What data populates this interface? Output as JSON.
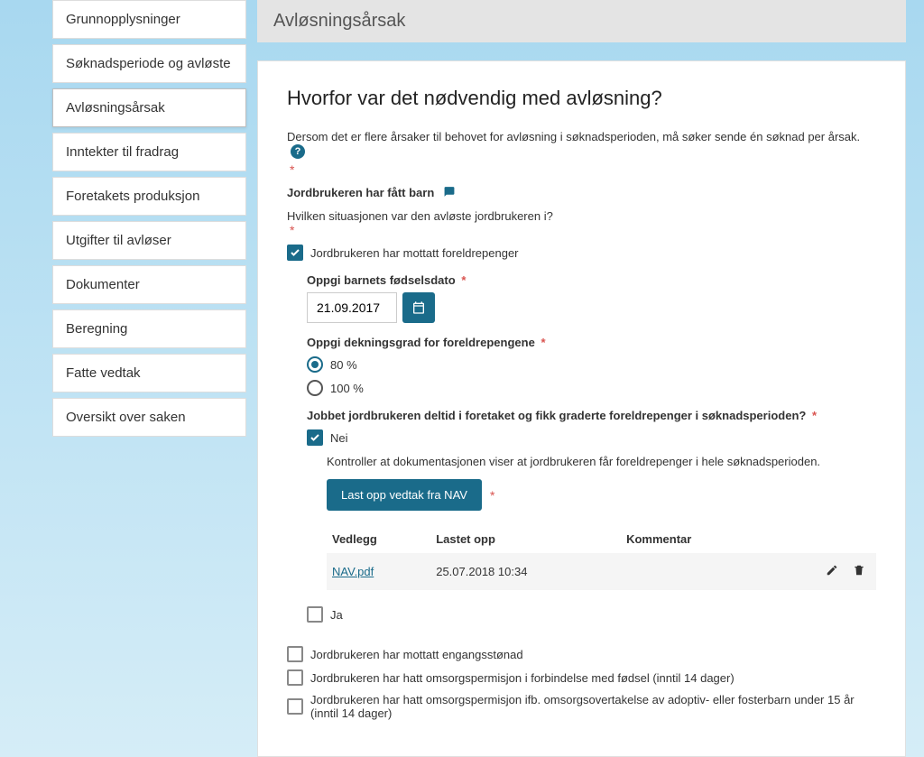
{
  "sidebar": {
    "items": [
      {
        "label": "Grunnopplysninger"
      },
      {
        "label": "Søknadsperiode og avløste"
      },
      {
        "label": "Avløsningsårsak"
      },
      {
        "label": "Inntekter til fradrag"
      },
      {
        "label": "Foretakets produksjon"
      },
      {
        "label": "Utgifter til avløser"
      },
      {
        "label": "Dokumenter"
      },
      {
        "label": "Beregning"
      },
      {
        "label": "Fatte vedtak"
      },
      {
        "label": "Oversikt over saken"
      }
    ]
  },
  "page": {
    "title": "Avløsningsårsak",
    "heading": "Hvorfor var det nødvendig med avløsning?",
    "intro": "Dersom det er flere årsaker til behovet for avløsning i søknadsperioden, må søker sende én søknad per årsak.",
    "reason_label": "Jordbrukeren har fått barn",
    "situation_q": "Hvilken situasjonen var den avløste jordbrukeren i?",
    "cb_foreldrepenger": "Jordbrukeren har mottatt foreldrepenger",
    "birthdate_label": "Oppgi barnets fødselsdato",
    "birthdate_value": "21.09.2017",
    "dekningsgrad_label": "Oppgi dekningsgrad for foreldrepengene",
    "radio_80": "80 %",
    "radio_100": "100 %",
    "deltid_q": "Jobbet jordbrukeren deltid i foretaket og fikk graderte foreldrepenger i søknadsperioden?",
    "nei": "Nei",
    "ja": "Ja",
    "kontroller": "Kontroller at dokumentasjonen viser at jordbrukeren får foreldrepenger i hele søknadsperioden.",
    "upload_btn": "Last opp vedtak fra NAV",
    "table": {
      "col_vedlegg": "Vedlegg",
      "col_lastet": "Lastet opp",
      "col_kommentar": "Kommentar",
      "rows": [
        {
          "file": "NAV.pdf",
          "date": "25.07.2018 10:34",
          "kommentar": ""
        }
      ]
    },
    "cb_engangs": "Jordbrukeren har mottatt engangsstønad",
    "cb_omsorg_fodsel": "Jordbrukeren har hatt omsorgspermisjon i forbindelse med fødsel (inntil 14 dager)",
    "cb_omsorg_adoptiv": "Jordbrukeren har hatt omsorgspermisjon ifb. omsorgsovertakelse av adoptiv- eller fosterbarn under 15 år (inntil 14 dager)"
  }
}
